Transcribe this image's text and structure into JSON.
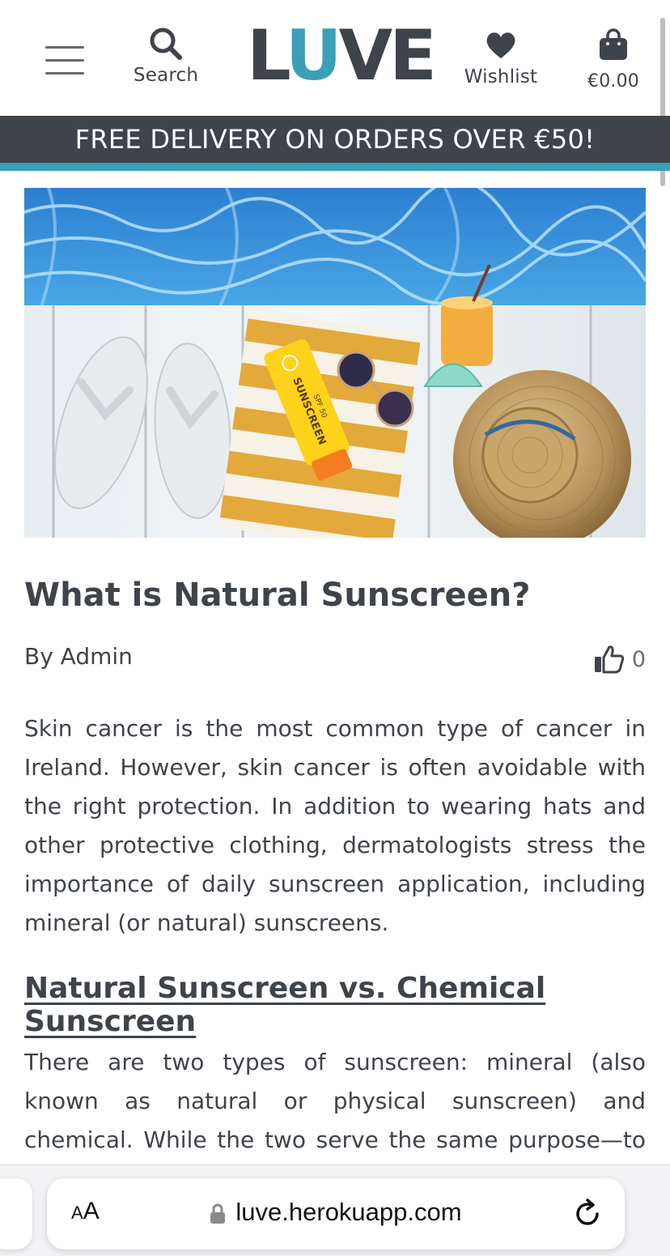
{
  "header": {
    "menu_icon": "hamburger-icon",
    "search_label": "Search",
    "search_icon": "search-icon",
    "logo_part1": "L",
    "logo_part2": "U",
    "logo_part3": "VE",
    "wishlist_label": "Wishlist",
    "wishlist_icon": "heart-icon",
    "cart_total": "€0.00",
    "cart_icon": "shopping-bag-icon",
    "brand_colors": {
      "dark": "#3f434a",
      "accent": "#3a9fb8"
    }
  },
  "promo": {
    "text": "FREE DELIVERY ON ORDERS OVER €50!"
  },
  "article": {
    "title": "What is Natural Sunscreen?",
    "author": "By Admin",
    "likes_icon": "thumbs-up-icon",
    "likes_count": "0",
    "paragraph1": "Skin cancer is the most common type of cancer in Ireland. However, skin cancer is often avoidable with the right protection. In addition to wearing hats and other protective clothing, dermatologists stress the importance of daily sunscreen application, including mineral (or natural) sunscreens.",
    "subheading": "Natural Sunscreen vs. Chemical Sunscreen",
    "paragraph2": "There are two types of sunscreen: mineral (also known as natural or physical sunscreen) and chemical. While the two serve the same purpose—to protect skin from"
  },
  "hero_image": {
    "sunscreen_text": "SUNSCREEN",
    "spf_text": "SPF 50"
  },
  "browser": {
    "aa_small": "A",
    "aa_big": "A",
    "url": "luve.herokuapp.com",
    "lock_icon": "lock-icon",
    "reload_icon": "reload-icon"
  }
}
